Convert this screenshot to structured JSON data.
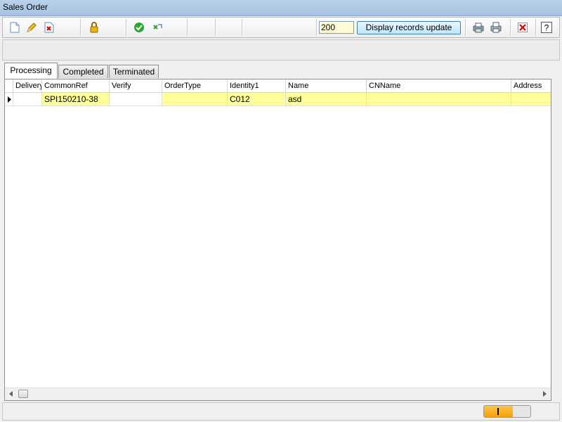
{
  "window": {
    "title": "Sales Order"
  },
  "toolbar": {
    "icons": [
      "new-document-icon",
      "edit-pencil-icon",
      "delete-icon",
      "lock-icon",
      "approve-check-icon",
      "reject-icon",
      "print-preview-icon",
      "print-icon",
      "close-icon",
      "help-icon"
    ],
    "record_count": "200",
    "update_label": "Display records update"
  },
  "tabs": [
    "Processing",
    "Completed",
    "Terminated"
  ],
  "active_tab": "Processing",
  "grid": {
    "columns": [
      "Delivery",
      "CommonRef",
      "Verify",
      "OrderType",
      "Identity1",
      "Name",
      "CNName",
      "Address"
    ],
    "rows": [
      {
        "Delivery": "",
        "CommonRef": "SPI150210-38",
        "Verify": "",
        "OrderType": "",
        "Identity1": "C012",
        "Name": "asd",
        "CNName": "",
        "Address": ""
      }
    ],
    "highlight_color": "#ffff99"
  },
  "status": {
    "progress_fraction": 0.62,
    "progress_color": "#f5a000"
  }
}
